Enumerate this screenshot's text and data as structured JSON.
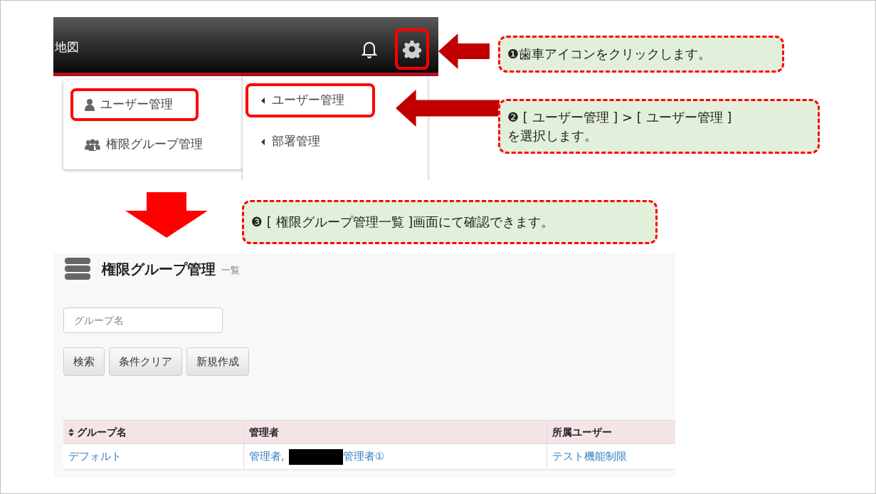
{
  "top_screenshot": {
    "header_title": "地図",
    "header_icons": [
      {
        "kind": "bell",
        "highlighted": false
      },
      {
        "kind": "gear",
        "highlighted": true
      }
    ],
    "menu": [
      {
        "label": "ユーザー管理",
        "kind": "user",
        "highlighted": true
      },
      {
        "label": "権限グループ管理",
        "kind": "group",
        "highlighted": false
      }
    ],
    "submenu": [
      {
        "label": "ユーザー管理",
        "highlighted": true
      },
      {
        "label": "部署管理",
        "highlighted": false
      }
    ]
  },
  "callouts": [
    {
      "text": "❶歯車アイコンをクリックします。"
    },
    {
      "text": "❷ [ ユーザー管理 ] > [ ユーザー管理 ]\nを選択します。"
    },
    {
      "text": "❸ [ 権限グループ管理一覧 ]画面にて確認できます。"
    }
  ],
  "list_page": {
    "title": "権限グループ管理",
    "subtitle": "一覧",
    "search": {
      "placeholder": "グループ名"
    },
    "buttons": [
      "検索",
      "条件クリア",
      "新規作成"
    ],
    "table": {
      "columns": [
        {
          "label": "グループ名",
          "sortable": true
        },
        {
          "label": "管理者",
          "sortable": false
        },
        {
          "label": "所属ユーザー",
          "sortable": false
        }
      ],
      "rows": [
        [
          [
            {
              "kind": "link",
              "text": "デフォルト"
            }
          ],
          [
            {
              "kind": "link",
              "text": "管理者,"
            },
            {
              "kind": "redacted"
            },
            {
              "kind": "link",
              "text": "管理者①"
            }
          ],
          [
            {
              "kind": "link",
              "text": "テスト機能制限"
            }
          ]
        ]
      ]
    }
  }
}
